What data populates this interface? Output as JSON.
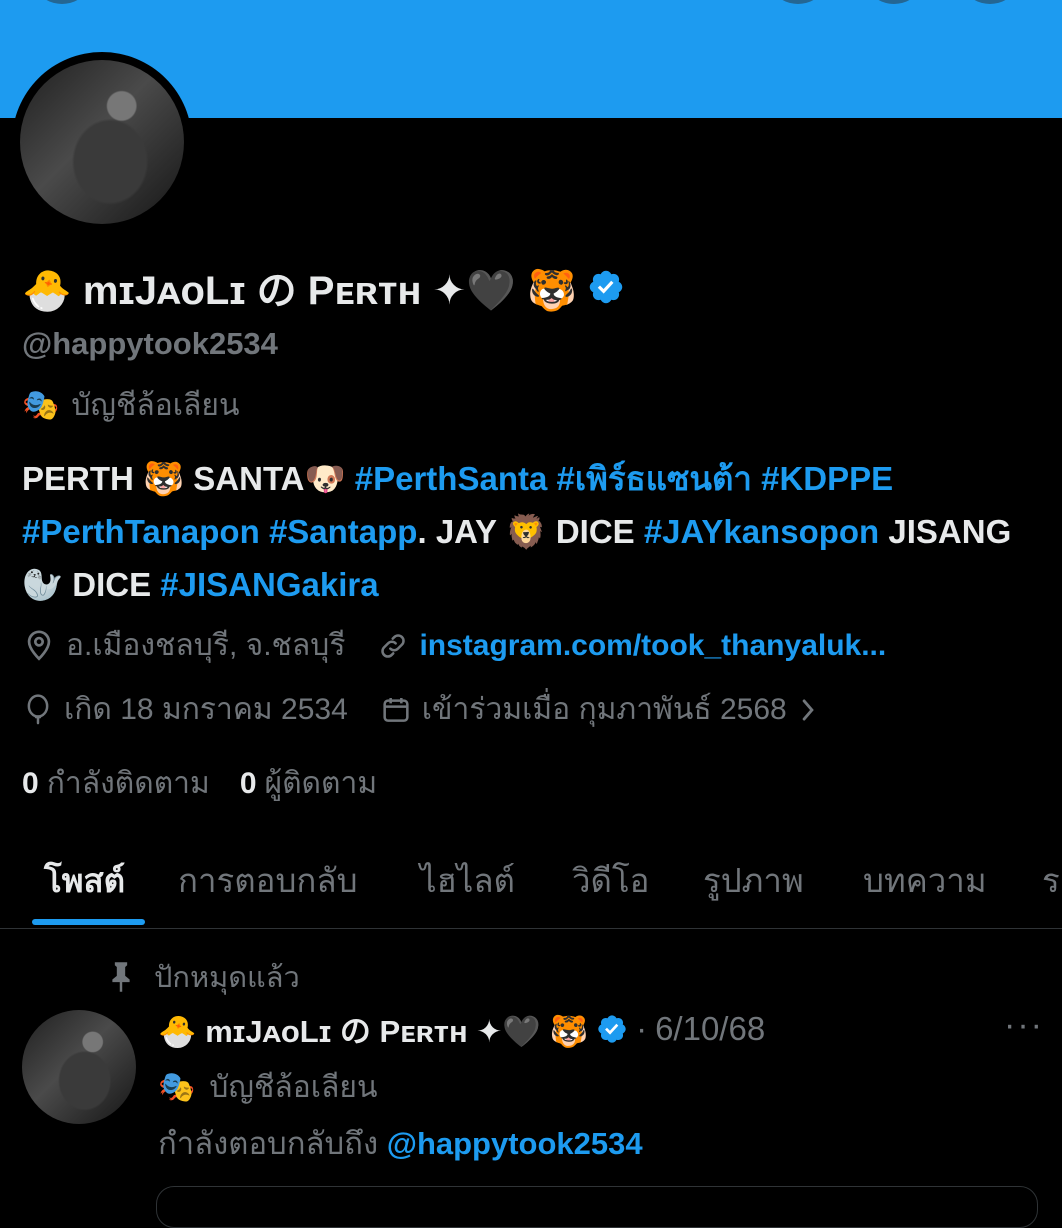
{
  "profile": {
    "display_name": "🐣 mɪJᴀᴏLɪ の Pᴇʀᴛʜ ✦🖤 🐯",
    "handle": "@happytook2534",
    "parody_label": "บัญชีล้อเลียน",
    "parody_icon": "🎭",
    "bio_segments": [
      {
        "text": "PERTH 🐯 SANTA🐶 ",
        "link": false
      },
      {
        "text": "#PerthSanta",
        "link": true
      },
      {
        "text": " ",
        "link": false
      },
      {
        "text": "#เพิร์ธแซนต้า",
        "link": true
      },
      {
        "text": " ",
        "link": false
      },
      {
        "text": "#KDPPE",
        "link": true
      },
      {
        "text": " ",
        "link": false
      },
      {
        "text": "#PerthTanapon",
        "link": true
      },
      {
        "text": " ",
        "link": false
      },
      {
        "text": "#Santapp",
        "link": true
      },
      {
        "text": ". JAY 🦁 DICE ",
        "link": false
      },
      {
        "text": "#JAYkansopon",
        "link": true
      },
      {
        "text": " JISANG 🦭 DICE ",
        "link": false
      },
      {
        "text": "#JISANGakira",
        "link": true
      }
    ],
    "location": "อ.เมืองชลบุรี, จ.ชลบุรี",
    "website": "instagram.com/took_thanyaluk...",
    "birthday": "เกิด 18 มกราคม 2534",
    "joined": "เข้าร่วมเมื่อ กุมภาพันธ์ 2568",
    "following_count": "0",
    "following_label": "กำลังติดตาม",
    "followers_count": "0",
    "followers_label": "ผู้ติดตาม"
  },
  "tabs": [
    "โพสต์",
    "การตอบกลับ",
    "ไฮไลต์",
    "วิดีโอ",
    "รูปภาพ",
    "บทความ",
    "ร"
  ],
  "post": {
    "pinned_label": "ปักหมุดแล้ว",
    "author": "🐣 mɪJᴀᴏLɪ の Pᴇʀᴛʜ ✦🖤 🐯",
    "separator": "·",
    "date": "6/10/68",
    "more": "···",
    "parody_label": "บัญชีล้อเลียน",
    "reply_prefix": "กำลังตอบกลับถึง",
    "reply_mention": "@happytook2534"
  },
  "colors": {
    "accent": "#1d9bf0",
    "background": "#000000",
    "text_primary": "#e7e9ea",
    "text_secondary": "#71767b",
    "divider": "#2f3336"
  }
}
